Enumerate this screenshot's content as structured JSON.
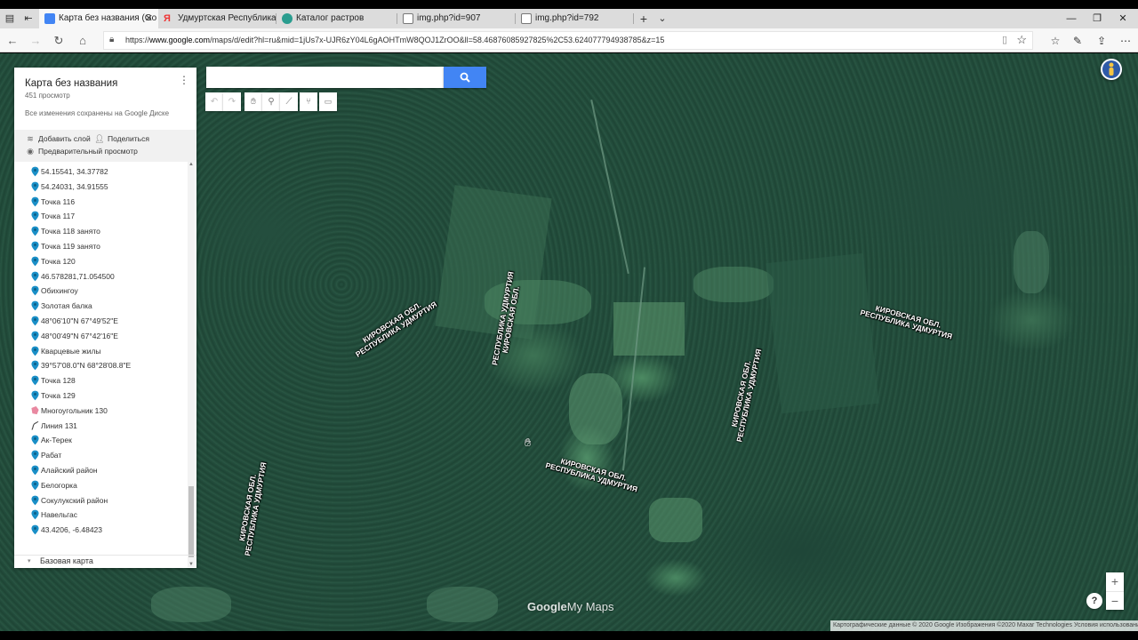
{
  "browser": {
    "tabs": [
      {
        "label": "Карта без названия (Go",
        "active": true,
        "favicon_color": "#4285f4"
      },
      {
        "label": "Удмуртская Республика —",
        "active": false,
        "favicon_color": "#e33"
      },
      {
        "label": "Каталог растров",
        "active": false,
        "favicon_color": "#2a9d8f"
      },
      {
        "label": "img.php?id=907",
        "active": false,
        "favicon_color": "#888"
      },
      {
        "label": "img.php?id=792",
        "active": false,
        "favicon_color": "#888"
      }
    ],
    "new_tab_label": "+",
    "tab_list_label": "⌄",
    "url_prefix": "https://",
    "url_host": "www.google.com",
    "url_path": "/maps/d/edit?hl=ru&mid=1jUs7x-UJR6zY04L6gAOHTmW8QOJ1ZrOO&ll=58.46876085927825%2C53.624077794938785&z=15"
  },
  "map": {
    "search": {
      "value": "",
      "placeholder": ""
    },
    "tools": [
      "undo",
      "redo",
      "select",
      "add-marker",
      "draw-line",
      "route",
      "measure"
    ],
    "labels": [
      {
        "line1": "КИРОВСКАЯ ОБЛ.",
        "line2": "РЕСПУБЛИКА УДМУРТИЯ"
      },
      {
        "line1": "РЕСПУБЛИКА УДМУРТИЯ",
        "line2": "КИРОВСКАЯ ОБЛ."
      },
      {
        "line1": "КИРОВСКАЯ ОБЛ.",
        "line2": "РЕСПУБЛИКА УДМУРТИЯ"
      },
      {
        "line1": "КИРОВСКАЯ ОБЛ.",
        "line2": "РЕСПУБЛИКА УДМУРТИЯ"
      },
      {
        "line1": "КИРОВСКАЯ ОБЛ.",
        "line2": "РЕСПУБЛИКА УДМУРТИЯ"
      },
      {
        "line1": "КИРОВСКАЯ ОБЛ.",
        "line2": "РЕСПУБЛИКА УДМУРТИЯ"
      }
    ],
    "logo_google": "Google",
    "logo_mymaps": "My Maps",
    "attribution": "Картографические данные © 2020 Google Изображения ©2020 Maxar Technologies   Условия использования",
    "zoom_in": "+",
    "zoom_out": "−",
    "help": "?"
  },
  "panel": {
    "title": "Карта без названия",
    "views": "451 просмотр",
    "saved_status": "Все изменения сохранены на Google Диске",
    "add_layer": "Добавить слой",
    "share": "Поделиться",
    "preview": "Предварительный просмотр",
    "items": [
      {
        "label": "54.15541, 34.37782",
        "type": "marker"
      },
      {
        "label": "54.24031, 34.91555",
        "type": "marker"
      },
      {
        "label": "Точка 116",
        "type": "marker"
      },
      {
        "label": "Точка 117",
        "type": "marker"
      },
      {
        "label": "Точка 118 занято",
        "type": "marker"
      },
      {
        "label": "Точка 119 занято",
        "type": "marker"
      },
      {
        "label": "Точка 120",
        "type": "marker"
      },
      {
        "label": "46.578281,71.054500",
        "type": "marker"
      },
      {
        "label": "Обихингоу",
        "type": "marker"
      },
      {
        "label": "Золотая балка",
        "type": "marker"
      },
      {
        "label": "48°06'10\"N 67°49'52\"E",
        "type": "marker"
      },
      {
        "label": "48°00'49\"N 67°42'16\"E",
        "type": "marker"
      },
      {
        "label": "Кварцевые жилы",
        "type": "marker"
      },
      {
        "label": "39°57'08.0\"N 68°28'08.8\"E",
        "type": "marker"
      },
      {
        "label": "Точка 128",
        "type": "marker"
      },
      {
        "label": "Точка 129",
        "type": "marker"
      },
      {
        "label": "Многоугольник 130",
        "type": "polygon"
      },
      {
        "label": "Линия 131",
        "type": "line"
      },
      {
        "label": "Ак-Терек",
        "type": "marker"
      },
      {
        "label": "Рабат",
        "type": "marker"
      },
      {
        "label": "Алайский район",
        "type": "marker"
      },
      {
        "label": "Белогорка",
        "type": "marker"
      },
      {
        "label": "Сокулукский район",
        "type": "marker"
      },
      {
        "label": "Навельгас",
        "type": "marker"
      },
      {
        "label": "43.4206, -6.48423",
        "type": "marker"
      }
    ],
    "base_map": "Базовая карта"
  },
  "colors": {
    "marker": "#1a8fc7",
    "polygon": "#e0577a",
    "accent": "#4285f4"
  }
}
